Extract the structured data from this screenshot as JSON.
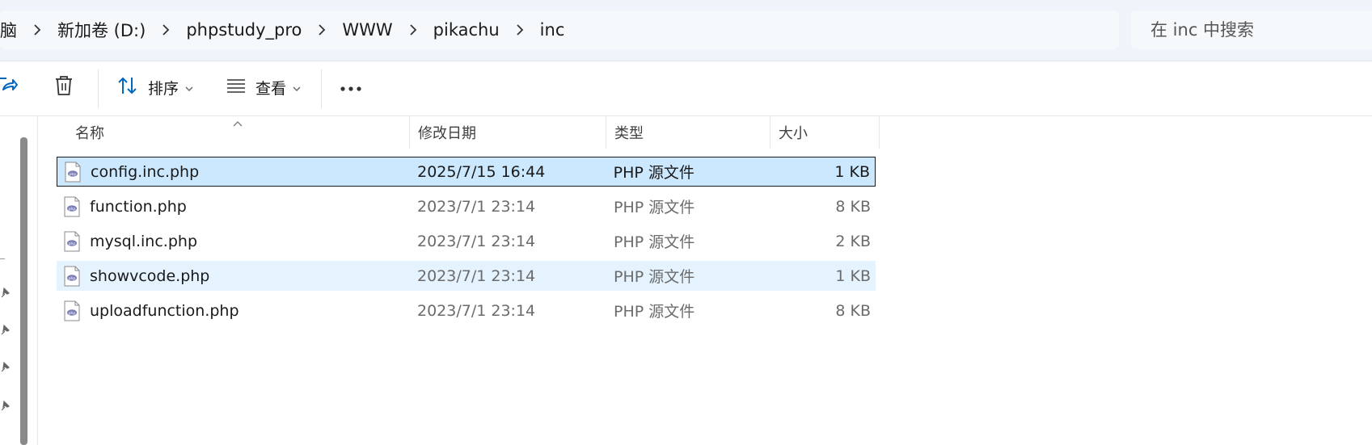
{
  "breadcrumb": {
    "items": [
      "脑",
      "新加卷 (D:)",
      "phpstudy_pro",
      "WWW",
      "pikachu",
      "inc"
    ]
  },
  "search": {
    "placeholder": "在 inc 中搜索"
  },
  "toolbar": {
    "sort_label": "排序",
    "view_label": "查看"
  },
  "columns": {
    "name": "名称",
    "date": "修改日期",
    "type": "类型",
    "size": "大小"
  },
  "files": [
    {
      "name": "config.inc.php",
      "date": "2025/7/15 16:44",
      "type": "PHP 源文件",
      "size": "1 KB"
    },
    {
      "name": "function.php",
      "date": "2023/7/1 23:14",
      "type": "PHP 源文件",
      "size": "8 KB"
    },
    {
      "name": "mysql.inc.php",
      "date": "2023/7/1 23:14",
      "type": "PHP 源文件",
      "size": "2 KB"
    },
    {
      "name": "showvcode.php",
      "date": "2023/7/1 23:14",
      "type": "PHP 源文件",
      "size": "1 KB"
    },
    {
      "name": "uploadfunction.php",
      "date": "2023/7/1 23:14",
      "type": "PHP 源文件",
      "size": "8 KB"
    }
  ],
  "colors": {
    "selected_row": "#cce8ff",
    "hover_row": "#e5f3ff",
    "accent": "#0067c0"
  }
}
